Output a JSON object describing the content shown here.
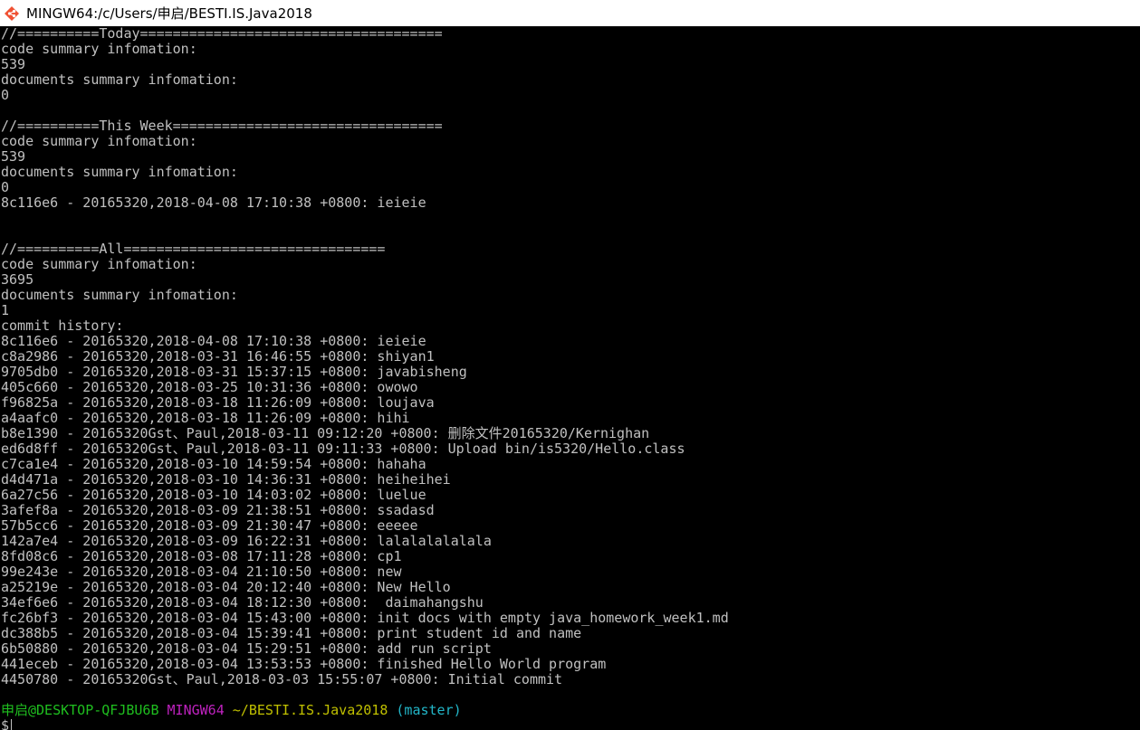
{
  "window": {
    "title": "MINGW64:/c/Users/申启/BESTI.IS.Java2018",
    "icon": "git-bash-icon"
  },
  "terminal": {
    "today": {
      "header": "//==========Today=====================================",
      "code_label": "code summary infomation:",
      "code_value": "539",
      "docs_label": "documents summary infomation:",
      "docs_value": "0"
    },
    "week": {
      "header": "//==========This Week=================================",
      "code_label": "code summary infomation:",
      "code_value": "539",
      "docs_label": "documents summary infomation:",
      "docs_value": "0",
      "commit": "8c116e6 - 20165320,2018-04-08 17:10:38 +0800: ieieie"
    },
    "all": {
      "header": "//==========All================================",
      "code_label": "code summary infomation:",
      "code_value": "3695",
      "docs_label": "documents summary infomation:",
      "docs_value": "1",
      "history_label": "commit history:",
      "commits": [
        "8c116e6 - 20165320,2018-04-08 17:10:38 +0800: ieieie",
        "c8a2986 - 20165320,2018-03-31 16:46:55 +0800: shiyan1",
        "9705db0 - 20165320,2018-03-31 15:37:15 +0800: javabisheng",
        "405c660 - 20165320,2018-03-25 10:31:36 +0800: owowo",
        "f96825a - 20165320,2018-03-18 11:26:09 +0800: loujava",
        "a4aafc0 - 20165320,2018-03-18 11:26:09 +0800: hihi",
        "b8e1390 - 20165320Gst、Paul,2018-03-11 09:12:20 +0800: 删除文件20165320/Kernighan",
        "ed6d8ff - 20165320Gst、Paul,2018-03-11 09:11:33 +0800: Upload bin/is5320/Hello.class",
        "c7ca1e4 - 20165320,2018-03-10 14:59:54 +0800: hahaha",
        "d4d471a - 20165320,2018-03-10 14:36:31 +0800: heiheihei",
        "6a27c56 - 20165320,2018-03-10 14:03:02 +0800: luelue",
        "3afef8a - 20165320,2018-03-09 21:38:51 +0800: ssadasd",
        "57b5cc6 - 20165320,2018-03-09 21:30:47 +0800: eeeee",
        "142a7e4 - 20165320,2018-03-09 16:22:31 +0800: lalalalalalala",
        "8fd08c6 - 20165320,2018-03-08 17:11:28 +0800: cp1",
        "99e243e - 20165320,2018-03-04 21:10:50 +0800: new",
        "a25219e - 20165320,2018-03-04 20:12:40 +0800: New Hello",
        "34ef6e6 - 20165320,2018-03-04 18:12:30 +0800:  daimahangshu",
        "fc26bf3 - 20165320,2018-03-04 15:43:00 +0800: init docs with empty java_homework_week1.md",
        "dc388b5 - 20165320,2018-03-04 15:39:41 +0800: print student id and name",
        "6b50880 - 20165320,2018-03-04 15:29:51 +0800: add run script",
        "441eceb - 20165320,2018-03-04 13:53:53 +0800: finished Hello World program",
        "4450780 - 20165320Gst、Paul,2018-03-03 15:55:07 +0800: Initial commit"
      ]
    },
    "prompt": {
      "user_host": "申启@DESKTOP-QFJBU6B",
      "system": "MINGW64",
      "path": "~/BESTI.IS.Java2018",
      "branch": "(master)",
      "symbol": "$"
    },
    "colors": {
      "background": "#000000",
      "text": "#c0c0c0",
      "user": "#1fbf1f",
      "system": "#bf22bf",
      "path": "#c0c000",
      "branch": "#22b6c8"
    }
  }
}
